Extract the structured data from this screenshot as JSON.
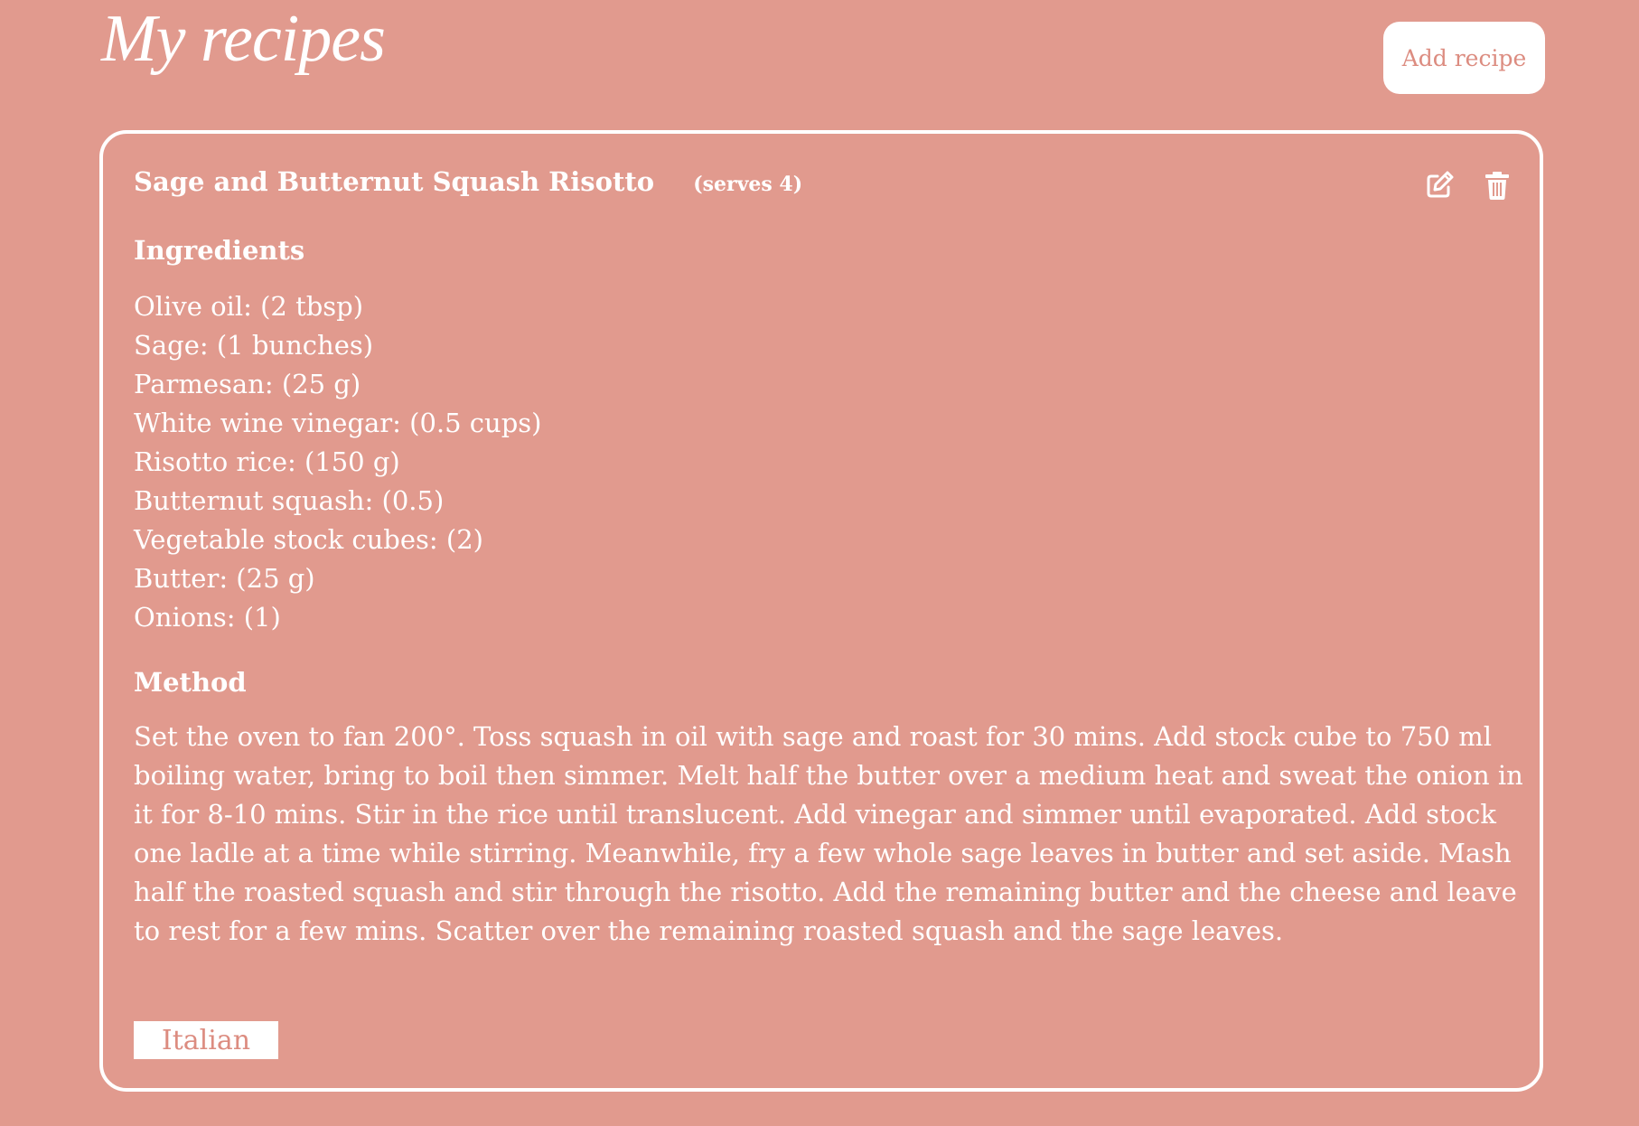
{
  "header": {
    "title": "My recipes",
    "add_button_label": "Add recipe"
  },
  "recipe": {
    "title": "Sage and Butternut Squash Risotto",
    "serves": "(serves 4)",
    "actions": {
      "edit_icon": "edit-icon",
      "delete_icon": "trash-icon"
    },
    "ingredients_heading": "Ingredients",
    "ingredients": [
      "Olive oil: (2 tbsp)",
      "Sage: (1 bunches)",
      "Parmesan: (25 g)",
      "White wine vinegar: (0.5 cups)",
      "Risotto rice: (150 g)",
      "Butternut squash: (0.5)",
      "Vegetable stock cubes: (2)",
      "Butter: (25 g)",
      "Onions: (1)"
    ],
    "method_heading": "Method",
    "method": "Set the oven to fan 200°. Toss squash in oil with sage and roast for 30 mins. Add stock cube to 750 ml boiling water, bring to boil then simmer. Melt half the butter over a medium heat and sweat the onion in it for 8-10 mins. Stir in the rice until translucent. Add vinegar and simmer until evaporated. Add stock one ladle at a time while stirring. Meanwhile, fry a few whole sage leaves in butter and set aside. Mash half the roasted squash and stir through the risotto. Add the remaining butter and the cheese and leave to rest for a few mins. Scatter over the remaining roasted squash and the sage leaves.",
    "tag": "Italian"
  },
  "colors": {
    "background": "#e19a8e",
    "accent_text": "#dc8c80",
    "foreground": "#ffffff"
  }
}
